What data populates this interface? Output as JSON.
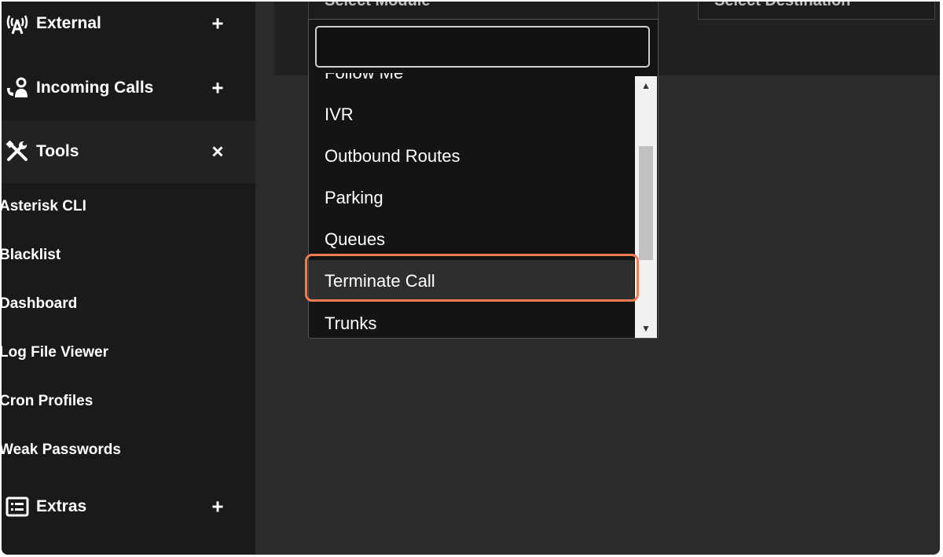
{
  "sidebar": {
    "sections": [
      {
        "label": "External",
        "icon": "broadcast-tower-icon",
        "toggle": "+"
      },
      {
        "label": "Incoming Calls",
        "icon": "incoming-call-user-icon",
        "toggle": "+"
      },
      {
        "label": "Tools",
        "icon": "tools-icon",
        "toggle": "×"
      },
      {
        "label": "Extras",
        "icon": "list-icon",
        "toggle": "+"
      }
    ],
    "tools_items": [
      "Asterisk CLI",
      "Blacklist",
      "Dashboard",
      "Log File Viewer",
      "Cron Profiles",
      "Weak Passwords"
    ]
  },
  "main": {
    "module_select_placeholder": "Select Module",
    "destination_select_placeholder": "Select Destination",
    "search_value": "",
    "options": [
      "Follow Me",
      "IVR",
      "Outbound Routes",
      "Parking",
      "Queues",
      "Terminate Call",
      "Trunks"
    ],
    "highlighted_option": "Terminate Call"
  },
  "colors": {
    "highlight_ring": "#f47b50",
    "sidebar_bg": "#1a1a1a",
    "content_bg": "#2b2b2b"
  }
}
